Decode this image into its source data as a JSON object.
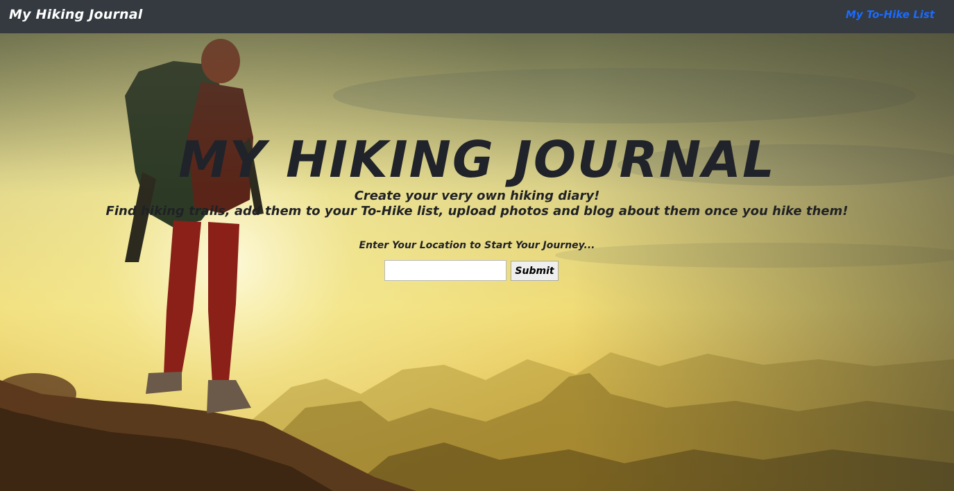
{
  "navbar": {
    "brand": "My Hiking Journal",
    "link": "My To-Hike List",
    "background": "#343a40",
    "link_color": "#1a6bff"
  },
  "hero": {
    "title": "MY HIKING JOURNAL",
    "subtitle_line1": "Create your very own hiking diary!",
    "subtitle_line2": "Find hiking trails, add them to your To-Hike list, upload photos and blog about them once you hike them!",
    "prompt": "Enter Your Location to Start Your Journey...",
    "background_image": "photo-of-hiker-on-mountain-at-sunset"
  },
  "search": {
    "value": "",
    "placeholder": "",
    "submit_label": "Submit"
  }
}
